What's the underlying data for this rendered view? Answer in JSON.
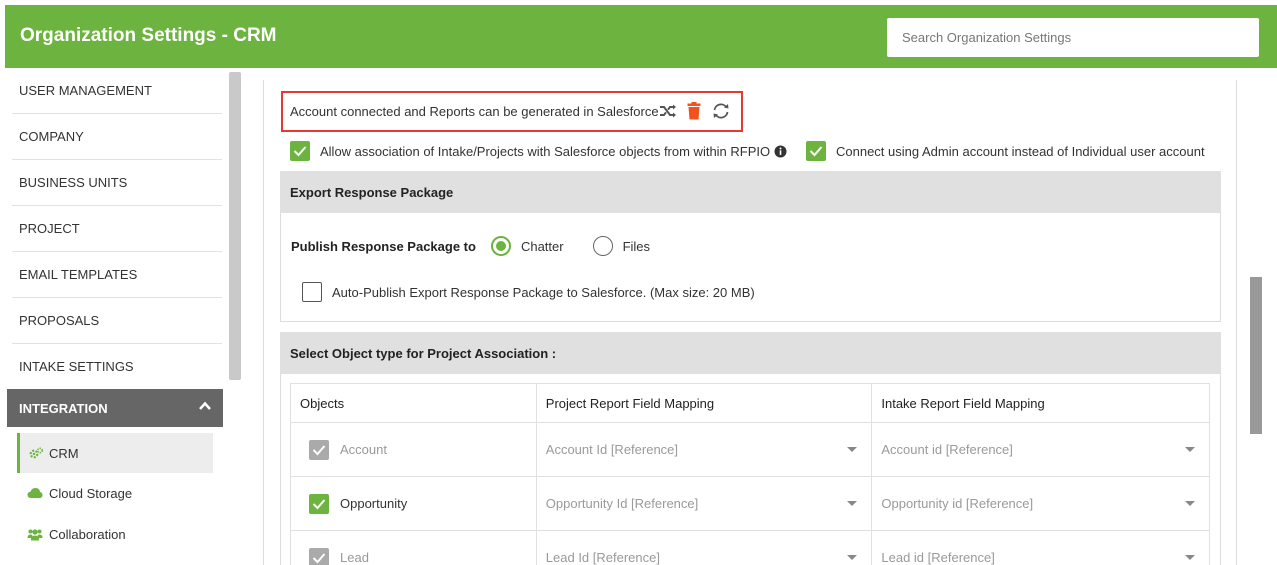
{
  "header": {
    "title": "Organization Settings - CRM",
    "search_placeholder": "Search Organization Settings",
    "bg_color": "#6db33f"
  },
  "sidebar": {
    "items": [
      {
        "label": "USER MANAGEMENT"
      },
      {
        "label": "COMPANY"
      },
      {
        "label": "BUSINESS UNITS"
      },
      {
        "label": "PROJECT"
      },
      {
        "label": "EMAIL TEMPLATES"
      },
      {
        "label": "PROPOSALS"
      },
      {
        "label": "INTAKE SETTINGS"
      }
    ],
    "integration": {
      "label": "INTEGRATION",
      "sub_items": [
        {
          "label": "CRM",
          "icon": "cogs-icon",
          "active": true
        },
        {
          "label": "Cloud Storage",
          "icon": "cloud-icon",
          "active": false
        },
        {
          "label": "Collaboration",
          "icon": "users-icon",
          "active": false
        }
      ]
    }
  },
  "status": {
    "text": "Account connected and Reports can be generated in Salesforce",
    "icons": [
      "shuffle-icon",
      "trash-icon",
      "sync-icon"
    ]
  },
  "options": {
    "allow_association_label": "Allow association of Intake/Projects with Salesforce objects from within RFPIO",
    "allow_association_checked": true,
    "admin_account_label": "Connect using Admin account instead of Individual user account",
    "admin_account_checked": true
  },
  "export_panel": {
    "title": "Export Response Package",
    "publish_label": "Publish Response Package to",
    "radio_options": [
      {
        "label": "Chatter",
        "selected": true
      },
      {
        "label": "Files",
        "selected": false
      }
    ],
    "auto_publish_label": "Auto-Publish Export Response Package to Salesforce. (Max size: 20 MB)",
    "auto_publish_checked": false
  },
  "association_panel": {
    "title": "Select Object type for Project Association :",
    "columns": [
      "Objects",
      "Project Report Field Mapping",
      "Intake Report Field Mapping"
    ],
    "rows": [
      {
        "object": "Account",
        "state": "disabled",
        "project_mapping": "Account Id [Reference]",
        "intake_mapping": "Account id [Reference]"
      },
      {
        "object": "Opportunity",
        "state": "checked",
        "project_mapping": "Opportunity Id [Reference]",
        "intake_mapping": "Opportunity id [Reference]"
      },
      {
        "object": "Lead",
        "state": "disabled",
        "project_mapping": "Lead Id [Reference]",
        "intake_mapping": "Lead id [Reference]"
      }
    ]
  },
  "colors": {
    "accent": "#6db33f",
    "danger": "#f4511e",
    "highlight_border": "#e53935"
  }
}
